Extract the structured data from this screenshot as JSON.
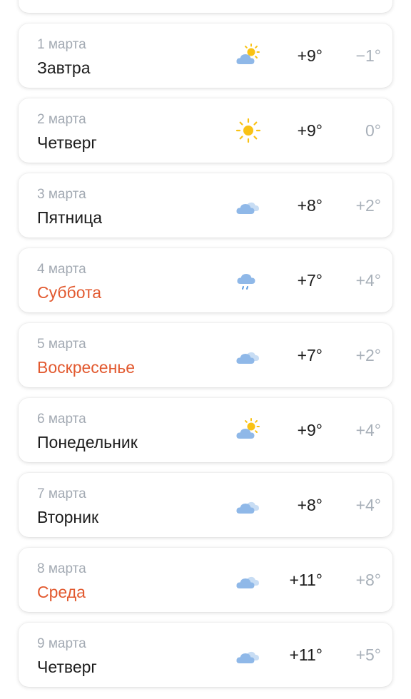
{
  "forecast": [
    {
      "date": "1 марта",
      "day": "Завтра",
      "weekend": false,
      "icon": "partly-cloudy-icon",
      "max": "+9°",
      "min": "−1°"
    },
    {
      "date": "2 марта",
      "day": "Четверг",
      "weekend": false,
      "icon": "sun-icon",
      "max": "+9°",
      "min": "0°"
    },
    {
      "date": "3 марта",
      "day": "Пятница",
      "weekend": false,
      "icon": "cloudy-icon",
      "max": "+8°",
      "min": "+2°"
    },
    {
      "date": "4 марта",
      "day": "Суббота",
      "weekend": true,
      "icon": "light-rain-icon",
      "max": "+7°",
      "min": "+4°"
    },
    {
      "date": "5 марта",
      "day": "Воскресенье",
      "weekend": true,
      "icon": "cloudy-icon",
      "max": "+7°",
      "min": "+2°"
    },
    {
      "date": "6 марта",
      "day": "Понедельник",
      "weekend": false,
      "icon": "partly-cloudy-icon",
      "max": "+9°",
      "min": "+4°"
    },
    {
      "date": "7 марта",
      "day": "Вторник",
      "weekend": false,
      "icon": "cloudy-icon",
      "max": "+8°",
      "min": "+4°"
    },
    {
      "date": "8 марта",
      "day": "Среда",
      "weekend": true,
      "icon": "cloudy-icon",
      "max": "+11°",
      "min": "+8°"
    },
    {
      "date": "9 марта",
      "day": "Четверг",
      "weekend": false,
      "icon": "cloudy-icon",
      "max": "+11°",
      "min": "+5°"
    }
  ],
  "colors": {
    "weekend": "#e2592f",
    "date_text": "#a3aab3",
    "min_temp": "#a8b0b9",
    "sun": "#f9c215",
    "cloud": "#8fb8e8"
  }
}
